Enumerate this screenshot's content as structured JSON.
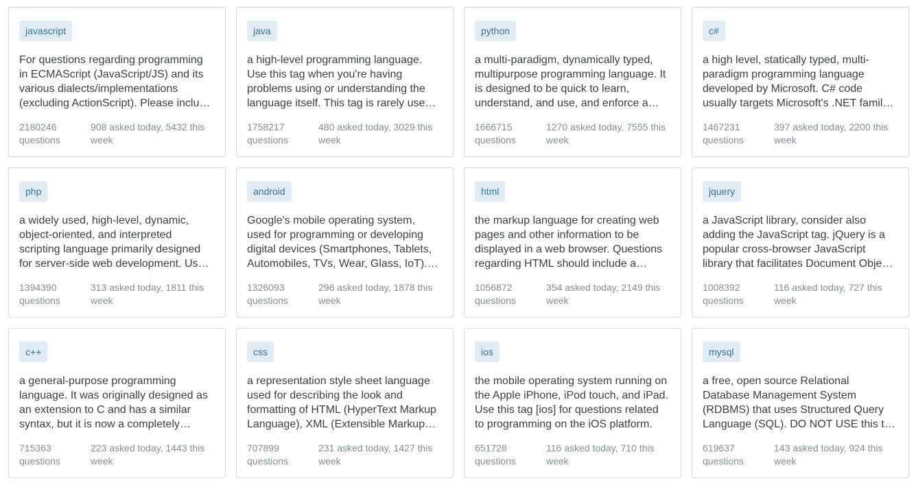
{
  "tags": [
    {
      "name": "javascript",
      "description": "For questions regarding programming in ECMAScript (JavaScript/JS) and its various dialects/implementations (excluding ActionScript). Please include all relevant tags on your question;",
      "count": "2180246",
      "count_label": "questions",
      "activity": "908 asked today, 5432 this week"
    },
    {
      "name": "java",
      "description": "a high-level programming language. Use this tag when you're having problems using or understanding the language itself. This tag is rarely used alone and is most often used in conjunction with other tags",
      "count": "1758217",
      "count_label": "questions",
      "activity": "480 asked today, 3029 this week"
    },
    {
      "name": "python",
      "description": "a multi-paradigm, dynamically typed, multipurpose programming language. It is designed to be quick to learn, understand, and use, and enforce a clean and uniform syntax.",
      "count": "1666715",
      "count_label": "questions",
      "activity": "1270 asked today, 7555 this week"
    },
    {
      "name": "c#",
      "description": "a high level, statically typed, multi-paradigm programming language developed by Microsoft. C# code usually targets Microsoft's .NET family of tools and run-times.",
      "count": "1467231",
      "count_label": "questions",
      "activity": "397 asked today, 2200 this week"
    },
    {
      "name": "php",
      "description": "a widely used, high-level, dynamic, object-oriented, and interpreted scripting language primarily designed for server-side web development. Used for questions about the PHP language.",
      "count": "1394390",
      "count_label": "questions",
      "activity": "313 asked today, 1811 this week"
    },
    {
      "name": "android",
      "description": "Google's mobile operating system, used for programming or developing digital devices (Smartphones, Tablets, Automobiles, TVs, Wear, Glass, IoT). For topics related to Android, use Android-specific tags.",
      "count": "1326093",
      "count_label": "questions",
      "activity": "296 asked today, 1878 this week"
    },
    {
      "name": "html",
      "description": "the markup language for creating web pages and other information to be displayed in a web browser. Questions regarding HTML should include a minimal reproducible example.",
      "count": "1056872",
      "count_label": "questions",
      "activity": "354 asked today, 2149 this week"
    },
    {
      "name": "jquery",
      "description": "a JavaScript library, consider also adding the JavaScript tag. jQuery is a popular cross-browser JavaScript library that facilitates Document Object Model (DOM) traversal, event handling, animations.",
      "count": "1008392",
      "count_label": "questions",
      "activity": "116 asked today, 727 this week"
    },
    {
      "name": "c++",
      "description": "a general-purpose programming language. It was originally designed as an extension to C and has a similar syntax, but it is now a completely different language.",
      "count": "715363",
      "count_label": "questions",
      "activity": "223 asked today, 1443 this week"
    },
    {
      "name": "css",
      "description": "a representation style sheet language used for describing the look and formatting of HTML (HyperText Markup Language), XML (Extensible Markup Language) documents and SVG elements.",
      "count": "707899",
      "count_label": "questions",
      "activity": "231 asked today, 1427 this week"
    },
    {
      "name": "ios",
      "description": "the mobile operating system running on the Apple iPhone, iPod touch, and iPad. Use this tag [ios] for questions related to programming on the iOS platform.",
      "count": "651728",
      "count_label": "questions",
      "activity": "116 asked today, 710 this week"
    },
    {
      "name": "mysql",
      "description": "a free, open source Relational Database Management System (RDBMS) that uses Structured Query Language (SQL). DO NOT USE this tag for other DBs such as SQL Server, SQLite etc.",
      "count": "619637",
      "count_label": "questions",
      "activity": "143 asked today, 924 this week"
    }
  ]
}
